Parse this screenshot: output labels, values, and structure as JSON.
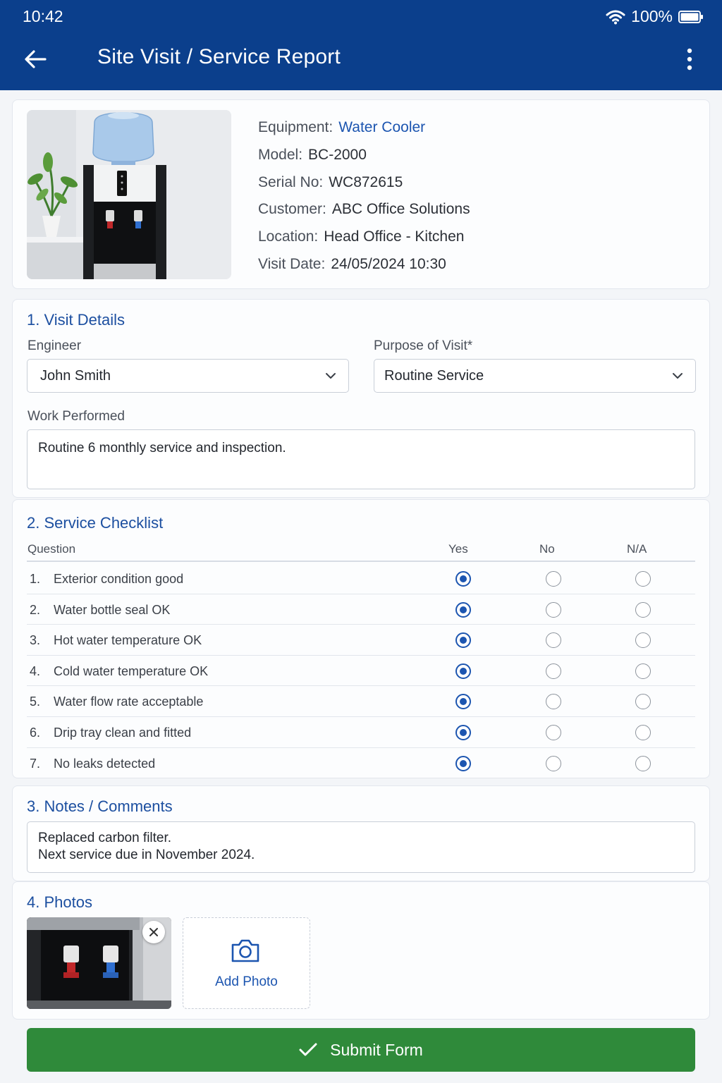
{
  "status_bar": {
    "time": "10:42",
    "battery": "100%"
  },
  "toolbar": {
    "title": "Site Visit / Service Report"
  },
  "equipment": {
    "equipment_label": "Equipment:",
    "equipment_value": "Water Cooler",
    "model_label": "Model:",
    "model_value": "BC-2000",
    "serial_label": "Serial No:",
    "serial_value": "WC872615",
    "customer_label": "Customer:",
    "customer_value": "ABC Office Solutions",
    "location_label": "Location:",
    "location_value": "Head Office - Kitchen",
    "date_label": "Visit Date:",
    "date_value": "24/05/2024 10:30"
  },
  "visit_details": {
    "title": "1.  Visit Details",
    "engineer_label": "Engineer",
    "engineer_value": "John Smith",
    "purpose_label": "Purpose of Visit*",
    "purpose_value": "Routine Service",
    "work_label": "Work Performed",
    "work_value": "Routine 6 monthly service and inspection."
  },
  "checklist": {
    "title": "2.  Service Checklist",
    "headers": {
      "question": "Question",
      "yes": "Yes",
      "no": "No",
      "na": "N/A"
    },
    "rows": [
      {
        "num": "1.",
        "question": "Exterior condition good",
        "answer": "yes"
      },
      {
        "num": "2.",
        "question": "Water bottle seal OK",
        "answer": "yes"
      },
      {
        "num": "3.",
        "question": "Hot water temperature OK",
        "answer": "yes"
      },
      {
        "num": "4.",
        "question": "Cold water temperature OK",
        "answer": "yes"
      },
      {
        "num": "5.",
        "question": "Water flow rate acceptable",
        "answer": "yes"
      },
      {
        "num": "6.",
        "question": "Drip tray clean and fitted",
        "answer": "yes"
      },
      {
        "num": "7.",
        "question": "No leaks detected",
        "answer": "yes"
      }
    ]
  },
  "notes": {
    "title": "3.  Notes / Comments",
    "line1": "Replaced carbon filter.",
    "line2": "Next service due in November 2024."
  },
  "photos": {
    "title": "4.  Photos",
    "add_label": "Add Photo"
  },
  "submit": {
    "label": "Submit Form"
  },
  "colors": {
    "primary": "#0b3f8c",
    "accent": "#1c55b0",
    "submit": "#2f8a3a"
  }
}
